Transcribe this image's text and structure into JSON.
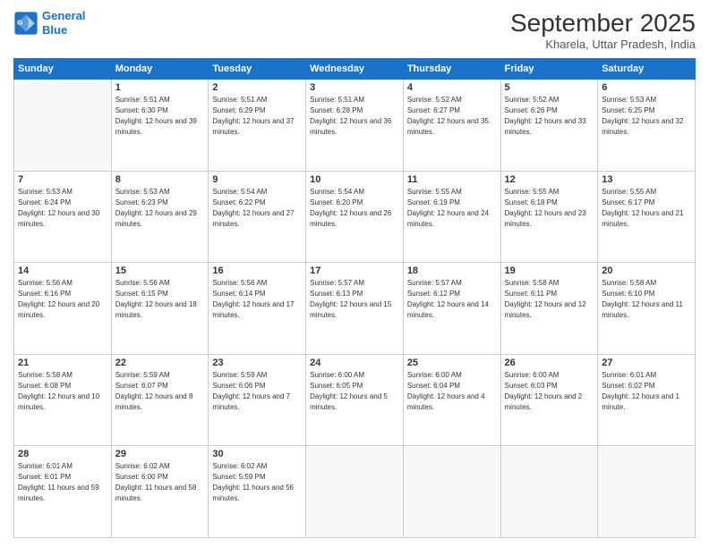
{
  "logo": {
    "line1": "General",
    "line2": "Blue"
  },
  "title": "September 2025",
  "subtitle": "Kharela, Uttar Pradesh, India",
  "days_header": [
    "Sunday",
    "Monday",
    "Tuesday",
    "Wednesday",
    "Thursday",
    "Friday",
    "Saturday"
  ],
  "weeks": [
    [
      {
        "num": "",
        "empty": true
      },
      {
        "num": "1",
        "sunrise": "5:51 AM",
        "sunset": "6:30 PM",
        "daylight": "12 hours and 39 minutes."
      },
      {
        "num": "2",
        "sunrise": "5:51 AM",
        "sunset": "6:29 PM",
        "daylight": "12 hours and 37 minutes."
      },
      {
        "num": "3",
        "sunrise": "5:51 AM",
        "sunset": "6:28 PM",
        "daylight": "12 hours and 36 minutes."
      },
      {
        "num": "4",
        "sunrise": "5:52 AM",
        "sunset": "6:27 PM",
        "daylight": "12 hours and 35 minutes."
      },
      {
        "num": "5",
        "sunrise": "5:52 AM",
        "sunset": "6:26 PM",
        "daylight": "12 hours and 33 minutes."
      },
      {
        "num": "6",
        "sunrise": "5:53 AM",
        "sunset": "6:25 PM",
        "daylight": "12 hours and 32 minutes."
      }
    ],
    [
      {
        "num": "7",
        "sunrise": "5:53 AM",
        "sunset": "6:24 PM",
        "daylight": "12 hours and 30 minutes."
      },
      {
        "num": "8",
        "sunrise": "5:53 AM",
        "sunset": "6:23 PM",
        "daylight": "12 hours and 29 minutes."
      },
      {
        "num": "9",
        "sunrise": "5:54 AM",
        "sunset": "6:22 PM",
        "daylight": "12 hours and 27 minutes."
      },
      {
        "num": "10",
        "sunrise": "5:54 AM",
        "sunset": "6:20 PM",
        "daylight": "12 hours and 26 minutes."
      },
      {
        "num": "11",
        "sunrise": "5:55 AM",
        "sunset": "6:19 PM",
        "daylight": "12 hours and 24 minutes."
      },
      {
        "num": "12",
        "sunrise": "5:55 AM",
        "sunset": "6:18 PM",
        "daylight": "12 hours and 23 minutes."
      },
      {
        "num": "13",
        "sunrise": "5:55 AM",
        "sunset": "6:17 PM",
        "daylight": "12 hours and 21 minutes."
      }
    ],
    [
      {
        "num": "14",
        "sunrise": "5:56 AM",
        "sunset": "6:16 PM",
        "daylight": "12 hours and 20 minutes."
      },
      {
        "num": "15",
        "sunrise": "5:56 AM",
        "sunset": "6:15 PM",
        "daylight": "12 hours and 18 minutes."
      },
      {
        "num": "16",
        "sunrise": "5:56 AM",
        "sunset": "6:14 PM",
        "daylight": "12 hours and 17 minutes."
      },
      {
        "num": "17",
        "sunrise": "5:57 AM",
        "sunset": "6:13 PM",
        "daylight": "12 hours and 15 minutes."
      },
      {
        "num": "18",
        "sunrise": "5:57 AM",
        "sunset": "6:12 PM",
        "daylight": "12 hours and 14 minutes."
      },
      {
        "num": "19",
        "sunrise": "5:58 AM",
        "sunset": "6:11 PM",
        "daylight": "12 hours and 12 minutes."
      },
      {
        "num": "20",
        "sunrise": "5:58 AM",
        "sunset": "6:10 PM",
        "daylight": "12 hours and 11 minutes."
      }
    ],
    [
      {
        "num": "21",
        "sunrise": "5:58 AM",
        "sunset": "6:08 PM",
        "daylight": "12 hours and 10 minutes."
      },
      {
        "num": "22",
        "sunrise": "5:59 AM",
        "sunset": "6:07 PM",
        "daylight": "12 hours and 8 minutes."
      },
      {
        "num": "23",
        "sunrise": "5:59 AM",
        "sunset": "6:06 PM",
        "daylight": "12 hours and 7 minutes."
      },
      {
        "num": "24",
        "sunrise": "6:00 AM",
        "sunset": "6:05 PM",
        "daylight": "12 hours and 5 minutes."
      },
      {
        "num": "25",
        "sunrise": "6:00 AM",
        "sunset": "6:04 PM",
        "daylight": "12 hours and 4 minutes."
      },
      {
        "num": "26",
        "sunrise": "6:00 AM",
        "sunset": "6:03 PM",
        "daylight": "12 hours and 2 minutes."
      },
      {
        "num": "27",
        "sunrise": "6:01 AM",
        "sunset": "6:02 PM",
        "daylight": "12 hours and 1 minute."
      }
    ],
    [
      {
        "num": "28",
        "sunrise": "6:01 AM",
        "sunset": "6:01 PM",
        "daylight": "11 hours and 59 minutes."
      },
      {
        "num": "29",
        "sunrise": "6:02 AM",
        "sunset": "6:00 PM",
        "daylight": "11 hours and 58 minutes."
      },
      {
        "num": "30",
        "sunrise": "6:02 AM",
        "sunset": "5:59 PM",
        "daylight": "11 hours and 56 minutes."
      },
      {
        "num": "",
        "empty": true
      },
      {
        "num": "",
        "empty": true
      },
      {
        "num": "",
        "empty": true
      },
      {
        "num": "",
        "empty": true
      }
    ]
  ]
}
